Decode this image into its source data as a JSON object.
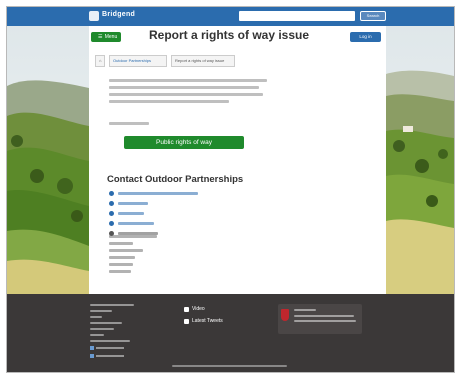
{
  "header": {
    "logo_text": "Bridgend",
    "search": {
      "placeholder": "",
      "button_label": "Search"
    }
  },
  "page": {
    "menu_label": "Menu",
    "title": "Report a rights of way issue",
    "login_label": "Log in",
    "breadcrumb": [
      {
        "label": "Outdoor Partnerships"
      },
      {
        "label": "Report a rights of way issue"
      }
    ],
    "cta_label": "Public rights of way",
    "contact_heading": "Contact Outdoor Partnerships",
    "contact_items": [
      {
        "icon": "email-icon"
      },
      {
        "icon": "link-icon"
      },
      {
        "icon": "link-icon"
      },
      {
        "icon": "twitter-icon"
      },
      {
        "icon": "location-icon"
      }
    ]
  },
  "footer": {
    "social": [
      {
        "label": "Video",
        "icon": "video-icon"
      },
      {
        "label": "Latest Tweets",
        "icon": "twitter-icon"
      }
    ]
  },
  "colors": {
    "header_blue": "#2b6cae",
    "primary_green": "#1f8a2c",
    "footer_dark": "#3b3838",
    "badge_red": "#c0262d"
  }
}
